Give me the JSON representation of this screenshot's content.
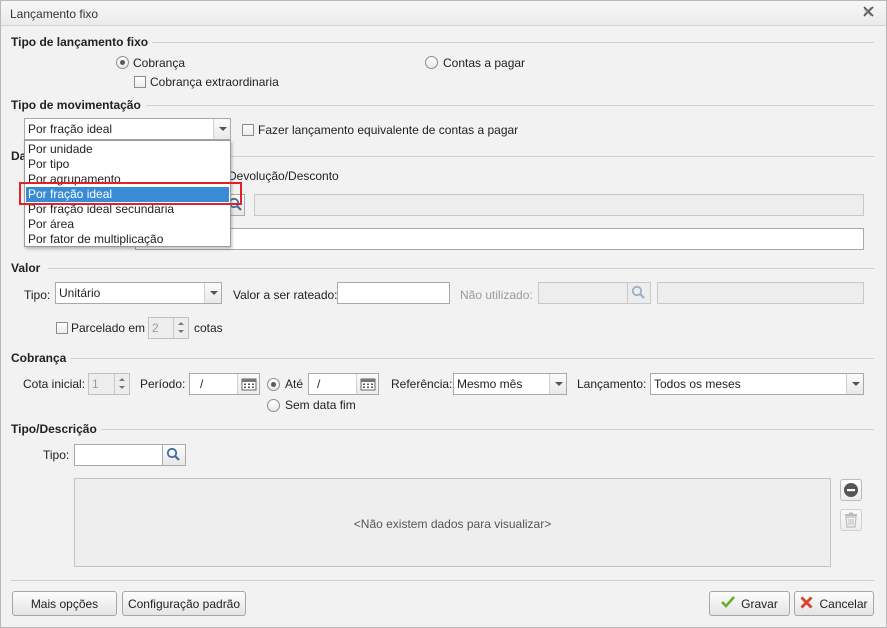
{
  "window": {
    "title": "Lançamento fixo"
  },
  "tipo_lancamento": {
    "heading": "Tipo de lançamento fixo",
    "cobranca_label": "Cobrança",
    "extraordinaria_label": "Cobrança extraordinaria",
    "contas_pagar_label": "Contas a pagar"
  },
  "movimentacao": {
    "heading": "Tipo de movimentação",
    "selected": "Por fração ideal",
    "equivalente_label": "Fazer lançamento equivalente de contas a pagar",
    "options": [
      "Por unidade",
      "Por tipo",
      "Por agrupamento",
      "Por fração ideal",
      "Por fração ideal secundaria",
      "Por área",
      "Por fator de multiplicação"
    ]
  },
  "dados": {
    "heading_partial": "Da",
    "devolucao_label": "Devolução/Desconto"
  },
  "valor": {
    "heading": "Valor",
    "tipo_label": "Tipo:",
    "tipo_value": "Unitário",
    "rateado_label": "Valor a ser rateado:",
    "rateado_value": "",
    "nao_utilizado_label": "Não utilizado:",
    "parcelado_label": "Parcelado em",
    "parcelas_value": "2",
    "cotas_label": "cotas"
  },
  "cobranca": {
    "heading": "Cobrança",
    "cota_inicial_label": "Cota inicial:",
    "cota_inicial_value": "1",
    "periodo_label": "Período:",
    "periodo_value": "/",
    "ate_label": "Até",
    "ate_value": "/",
    "sem_data_fim_label": "Sem data fim",
    "referencia_label": "Referência:",
    "referencia_value": "Mesmo mês",
    "lancamento_label": "Lançamento:",
    "lancamento_value": "Todos os meses"
  },
  "tipo_descricao": {
    "heading": "Tipo/Descrição",
    "tipo_label": "Tipo:",
    "tipo_value": "",
    "empty_message": "<Não existem dados para visualizar>"
  },
  "footer": {
    "mais_opcoes": "Mais opções",
    "configuracao_padrao": "Configuração padrão",
    "gravar": "Gravar",
    "cancelar": "Cancelar"
  },
  "colors": {
    "selection": "#3a8bd6",
    "highlight": "#e2202a",
    "gravar_icon": "#6cab2f",
    "cancelar_icon": "#d9412a"
  }
}
